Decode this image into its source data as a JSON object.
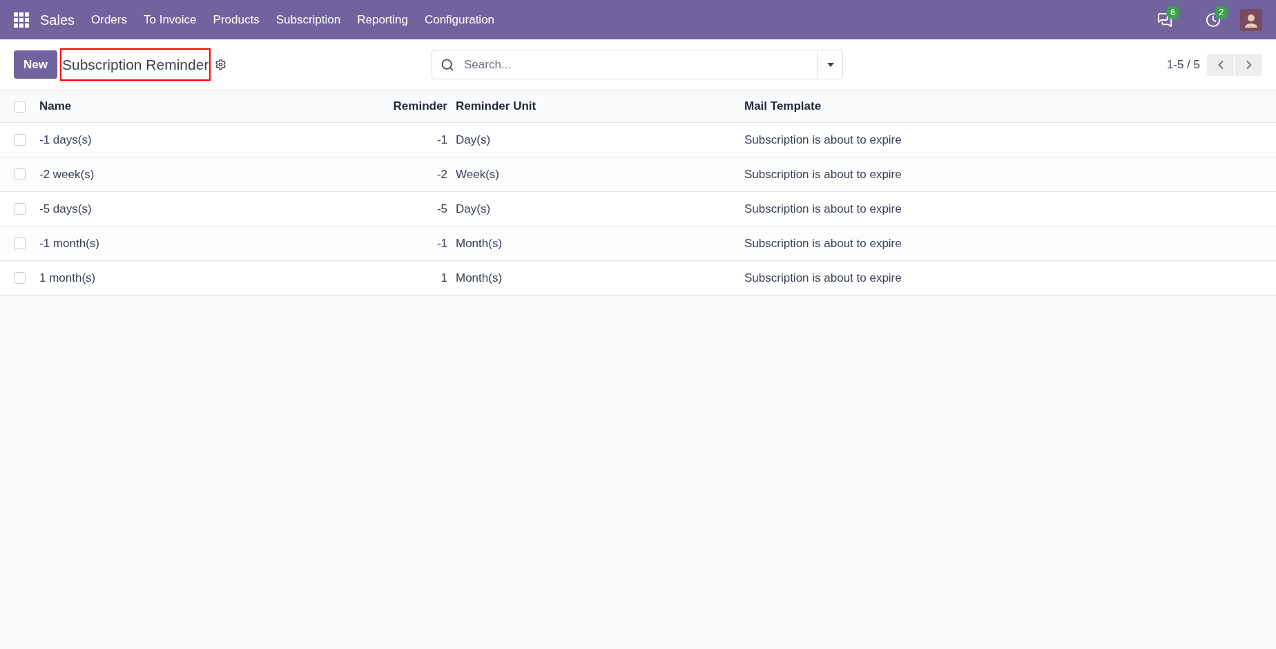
{
  "navbar": {
    "app": "Sales",
    "menu": [
      "Orders",
      "To Invoice",
      "Products",
      "Subscription",
      "Reporting",
      "Configuration"
    ],
    "messages_count": "6",
    "activities_count": "2"
  },
  "control_panel": {
    "new_button": "New",
    "title": "Subscription Reminder",
    "search": {
      "placeholder": "Search..."
    },
    "pager": "1-5 / 5"
  },
  "table": {
    "all_selected": false,
    "columns": [
      "Name",
      "Reminder",
      "Reminder Unit",
      "Mail Template"
    ],
    "rows": [
      {
        "name": "-1 days(s)",
        "reminder": "-1",
        "unit": "Day(s)",
        "template": "Subscription is about to expire",
        "selected": false
      },
      {
        "name": "-2 week(s)",
        "reminder": "-2",
        "unit": "Week(s)",
        "template": "Subscription is about to expire",
        "selected": false
      },
      {
        "name": "-5 days(s)",
        "reminder": "-5",
        "unit": "Day(s)",
        "template": "Subscription is about to expire",
        "selected": false
      },
      {
        "name": "-1 month(s)",
        "reminder": "-1",
        "unit": "Month(s)",
        "template": "Subscription is about to expire",
        "selected": false
      },
      {
        "name": "1 month(s)",
        "reminder": "1",
        "unit": "Month(s)",
        "template": "Subscription is about to expire",
        "selected": false
      }
    ]
  }
}
